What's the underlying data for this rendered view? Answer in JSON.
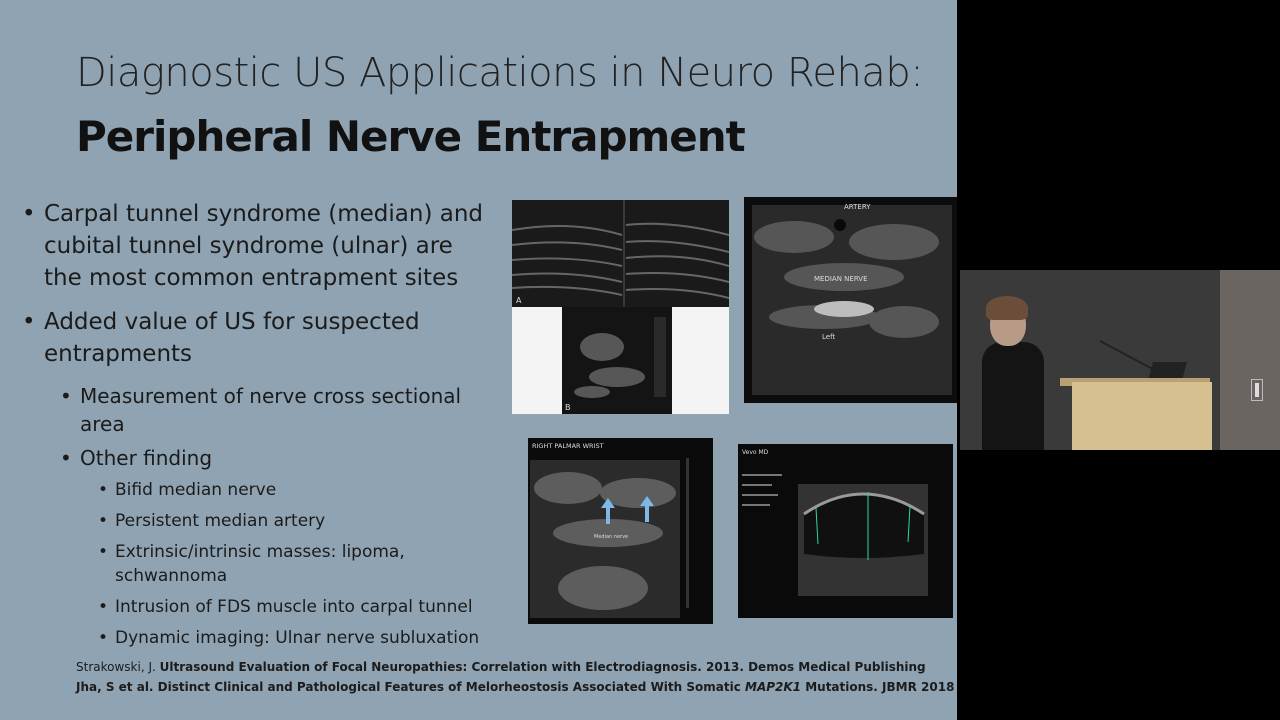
{
  "slide": {
    "title_line1": "Diagnostic US Applications in Neuro Rehab:",
    "title_line2": "Peripheral Nerve Entrapment",
    "bullets": {
      "b1": "Carpal tunnel syndrome (median) and cubital tunnel syndrome (ulnar) are the most common entrapment sites",
      "b2": "Added value of US for suspected entrapments",
      "b2_sub1": "Measurement of nerve cross sectional area",
      "b2_sub2": "Other finding",
      "b2_sub2_items": [
        "Bifid median nerve",
        "Persistent median artery",
        "Extrinsic/intrinsic masses: lipoma, schwannoma",
        "Intrusion of FDS muscle into carpal tunnel",
        "Dynamic imaging: Ulnar nerve subluxation"
      ]
    },
    "references": {
      "ref1_author": "Strakowski, J. ",
      "ref1_title": "Ultrasound Evaluation of Focal Neuropathies: Correlation with Electrodiagnosis. 2013. Demos Medical Publishing",
      "ref2_pre": "Jha, S et al. Distinct Clinical and Pathological Features of Melorheostosis Associated With Somatic ",
      "ref2_gene": "MAP2K1",
      "ref2_post": " Mutations. JBMR 2018"
    },
    "images": {
      "img1_label_a": "A",
      "img1_label_b": "B",
      "img2_labels": [
        "ARTERY",
        "MEDIAN NERVE",
        "Left"
      ],
      "img3_header": "RIGHT PALMAR WRIST",
      "img3_labels": [
        "Median nerve"
      ],
      "img4_header": "Vevo MD"
    }
  },
  "icons": {
    "side_control": "scroll-handle-icon"
  }
}
